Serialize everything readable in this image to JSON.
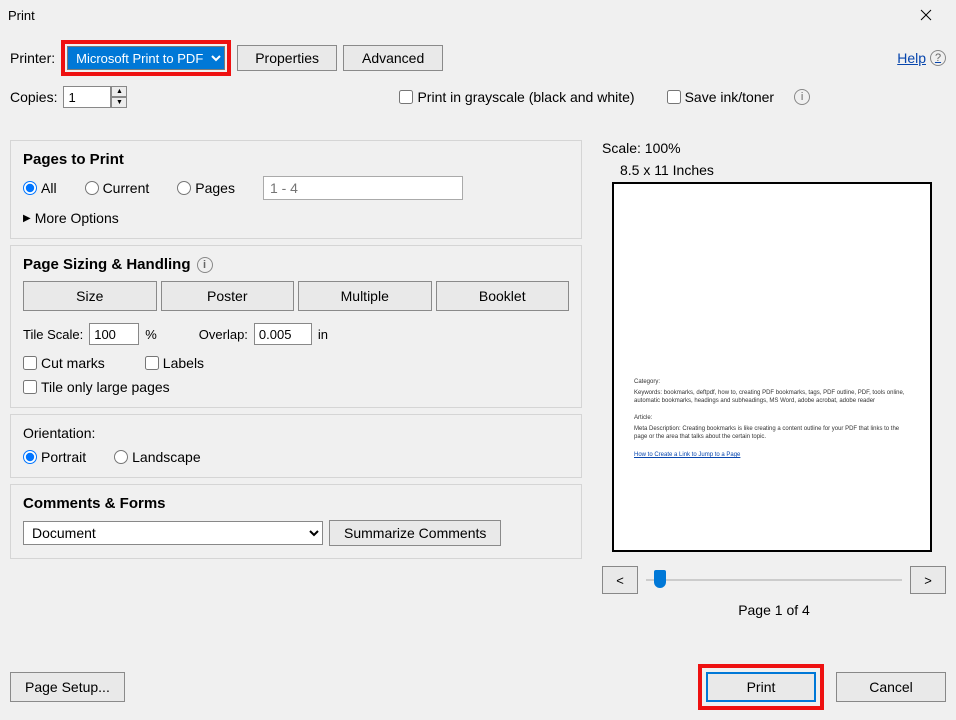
{
  "window": {
    "title": "Print"
  },
  "printer": {
    "label": "Printer:",
    "selected": "Microsoft Print to PDF",
    "properties_btn": "Properties",
    "advanced_btn": "Advanced",
    "help_label": "Help"
  },
  "copies": {
    "label": "Copies:",
    "value": "1",
    "grayscale_label": "Print in grayscale (black and white)",
    "save_ink_label": "Save ink/toner"
  },
  "pages_to_print": {
    "title": "Pages to Print",
    "all": "All",
    "current": "Current",
    "pages": "Pages",
    "range_placeholder": "1 - 4",
    "more_options": "More Options"
  },
  "sizing": {
    "title": "Page Sizing & Handling",
    "size_btn": "Size",
    "poster_btn": "Poster",
    "multiple_btn": "Multiple",
    "booklet_btn": "Booklet",
    "tile_scale_label": "Tile Scale:",
    "tile_scale_value": "100",
    "tile_scale_unit": "%",
    "overlap_label": "Overlap:",
    "overlap_value": "0.005",
    "overlap_unit": "in",
    "cut_marks": "Cut marks",
    "labels": "Labels",
    "tile_only": "Tile only large pages"
  },
  "orientation": {
    "title": "Orientation:",
    "portrait": "Portrait",
    "landscape": "Landscape"
  },
  "comments": {
    "title": "Comments & Forms",
    "selected": "Document",
    "summarize_btn": "Summarize Comments"
  },
  "preview": {
    "scale": "Scale: 100%",
    "dimensions": "8.5 x 11 Inches",
    "doc_category": "Category:",
    "doc_keywords": "Keywords: bookmarks, deftpdf, how to, creating PDF bookmarks, tags, PDF outline, PDF, tools online, automatic bookmarks, headings and subheadings, MS Word, adobe acrobat, adobe reader",
    "doc_article": "Article:",
    "doc_meta": "Meta Description: Creating bookmarks is like creating a content outline for your PDF that links to the page or the area that talks about the certain topic.",
    "doc_link": "How to Create a Link to Jump to a Page",
    "nav_prev": "<",
    "nav_next": ">",
    "page_of": "Page 1 of 4"
  },
  "footer": {
    "page_setup": "Page Setup...",
    "print": "Print",
    "cancel": "Cancel"
  }
}
